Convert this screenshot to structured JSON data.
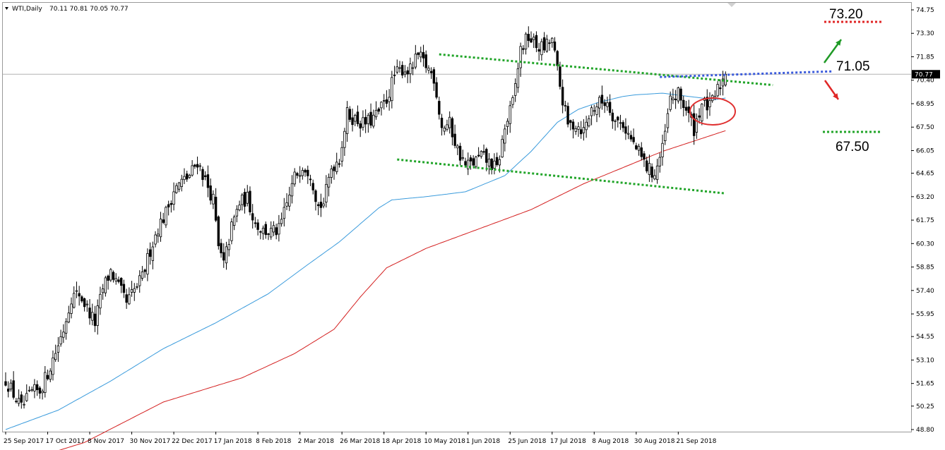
{
  "header": {
    "symbol": "WTI,Daily",
    "ohlc": "70.11 70.81 70.05 70.77"
  },
  "chart_data": {
    "type": "candlestick",
    "title": "WTI,Daily",
    "ylim": [
      48.8,
      74.75
    ],
    "y_ticks": [
      "74.75",
      "73.30",
      "71.85",
      "70.40",
      "68.95",
      "67.50",
      "66.05",
      "64.65",
      "63.20",
      "61.75",
      "60.30",
      "58.85",
      "57.40",
      "55.95",
      "54.55",
      "53.10",
      "51.65",
      "50.25",
      "48.80"
    ],
    "x_ticks": [
      "25 Sep 2017",
      "17 Oct 2017",
      "8 Nov 2017",
      "30 Nov 2017",
      "22 Dec 2017",
      "17 Jan 2018",
      "8 Feb 2018",
      "2 Mar 2018",
      "26 Mar 2018",
      "18 Apr 2018",
      "10 May 2018",
      "1 Jun 2018",
      "25 Jun 2018",
      "17 Jul 2018",
      "8 Aug 2018",
      "30 Aug 2018",
      "21 Sep 2018"
    ],
    "current_price": "70.77",
    "close_anchors": [
      [
        0,
        51.9
      ],
      [
        3,
        51.0
      ],
      [
        6,
        50.1
      ],
      [
        10,
        51.1
      ],
      [
        13,
        51.2
      ],
      [
        16,
        52.3
      ],
      [
        19,
        53.6
      ],
      [
        22,
        55.0
      ],
      [
        25,
        57.0
      ],
      [
        28,
        57.2
      ],
      [
        31,
        56.3
      ],
      [
        34,
        55.4
      ],
      [
        37,
        57.5
      ],
      [
        40,
        58.6
      ],
      [
        43,
        57.6
      ],
      [
        46,
        56.6
      ],
      [
        49,
        57.4
      ],
      [
        52,
        58.2
      ],
      [
        55,
        59.9
      ],
      [
        58,
        61.3
      ],
      [
        61,
        62.2
      ],
      [
        64,
        63.6
      ],
      [
        67,
        64.1
      ],
      [
        70,
        64.5
      ],
      [
        73,
        65.4
      ],
      [
        76,
        64.2
      ],
      [
        79,
        63.0
      ],
      [
        81,
        60.0
      ],
      [
        83,
        59.0
      ],
      [
        86,
        61.3
      ],
      [
        89,
        62.8
      ],
      [
        92,
        63.1
      ],
      [
        95,
        61.6
      ],
      [
        98,
        61.1
      ],
      [
        101,
        61.0
      ],
      [
        104,
        61.1
      ],
      [
        107,
        62.7
      ],
      [
        110,
        64.4
      ],
      [
        113,
        65.2
      ],
      [
        116,
        64.7
      ],
      [
        119,
        62.6
      ],
      [
        121,
        62.8
      ],
      [
        124,
        65.0
      ],
      [
        127,
        65.6
      ],
      [
        130,
        68.3
      ],
      [
        133,
        68.0
      ],
      [
        136,
        67.7
      ],
      [
        139,
        67.9
      ],
      [
        142,
        68.4
      ],
      [
        145,
        69.2
      ],
      [
        148,
        70.7
      ],
      [
        151,
        71.1
      ],
      [
        154,
        71.0
      ],
      [
        157,
        71.9
      ],
      [
        160,
        71.3
      ],
      [
        163,
        70.6
      ],
      [
        166,
        67.5
      ],
      [
        169,
        67.7
      ],
      [
        172,
        66.1
      ],
      [
        175,
        65.1
      ],
      [
        178,
        65.3
      ],
      [
        181,
        65.7
      ],
      [
        184,
        65.3
      ],
      [
        187,
        64.9
      ],
      [
        190,
        67.4
      ],
      [
        193,
        69.0
      ],
      [
        196,
        72.3
      ],
      [
        199,
        73.1
      ],
      [
        202,
        72.5
      ],
      [
        205,
        72.4
      ],
      [
        208,
        72.9
      ],
      [
        211,
        70.0
      ],
      [
        214,
        67.6
      ],
      [
        217,
        67.7
      ],
      [
        220,
        67.3
      ],
      [
        223,
        68.6
      ],
      [
        226,
        69.0
      ],
      [
        229,
        69.1
      ],
      [
        232,
        67.9
      ],
      [
        235,
        67.7
      ],
      [
        238,
        66.7
      ],
      [
        241,
        65.9
      ],
      [
        244,
        65.0
      ],
      [
        247,
        64.6
      ],
      [
        250,
        66.1
      ],
      [
        253,
        69.2
      ],
      [
        256,
        69.5
      ],
      [
        259,
        68.6
      ],
      [
        262,
        67.4
      ],
      [
        265,
        69.0
      ],
      [
        268,
        68.7
      ],
      [
        271,
        69.8
      ],
      [
        274,
        70.77
      ]
    ],
    "ma_fast_anchors": [
      [
        0,
        48.8
      ],
      [
        20,
        50.0
      ],
      [
        40,
        51.8
      ],
      [
        60,
        53.8
      ],
      [
        80,
        55.4
      ],
      [
        100,
        57.2
      ],
      [
        115,
        59.0
      ],
      [
        127,
        60.4
      ],
      [
        132,
        61.1
      ],
      [
        137,
        61.8
      ],
      [
        142,
        62.5
      ],
      [
        147,
        63.0
      ],
      [
        160,
        63.2
      ],
      [
        175,
        63.5
      ],
      [
        190,
        64.5
      ],
      [
        200,
        66.0
      ],
      [
        210,
        67.8
      ],
      [
        218,
        68.6
      ],
      [
        225,
        69.0
      ],
      [
        230,
        69.2
      ],
      [
        235,
        69.4
      ],
      [
        240,
        69.5
      ],
      [
        250,
        69.6
      ],
      [
        260,
        69.4
      ],
      [
        270,
        69.2
      ],
      [
        274,
        69.3
      ]
    ],
    "ma_slow_anchors": [
      [
        0,
        46.5
      ],
      [
        30,
        48.0
      ],
      [
        60,
        50.5
      ],
      [
        90,
        52.0
      ],
      [
        110,
        53.5
      ],
      [
        125,
        55.0
      ],
      [
        135,
        57.0
      ],
      [
        145,
        58.8
      ],
      [
        160,
        60.0
      ],
      [
        180,
        61.2
      ],
      [
        200,
        62.4
      ],
      [
        220,
        64.0
      ],
      [
        235,
        65.0
      ],
      [
        250,
        66.0
      ],
      [
        265,
        66.8
      ],
      [
        280,
        67.6
      ],
      [
        290,
        68.0
      ],
      [
        298,
        68.4
      ],
      [
        308,
        68.7
      ],
      [
        320,
        68.85
      ],
      [
        330,
        68.95
      ],
      [
        340,
        69.2
      ],
      [
        350,
        69.3
      ]
    ],
    "trend_lines": {
      "upper_channel": {
        "from": [
          165,
          72.0
        ],
        "to": [
          292,
          70.1
        ]
      },
      "lower_channel": {
        "from": [
          149,
          65.5
        ],
        "to": [
          274,
          63.4
        ]
      },
      "resistance_71_05": {
        "from": [
          249,
          70.6
        ],
        "to": [
          315,
          70.95
        ]
      }
    },
    "labels": {
      "upper_target": "73.20",
      "resistance": "71.05",
      "support": "67.50"
    },
    "colors": {
      "bull_body": "#ffffff",
      "bear_body": "#000000",
      "ma_fast": "#3a9bdc",
      "ma_slow": "#d42020",
      "channel": "#22a52a",
      "resistance": "#3b5bdb",
      "target": "#e02626",
      "up_arrow": "#1f9a26",
      "down_arrow": "#e02626"
    }
  }
}
